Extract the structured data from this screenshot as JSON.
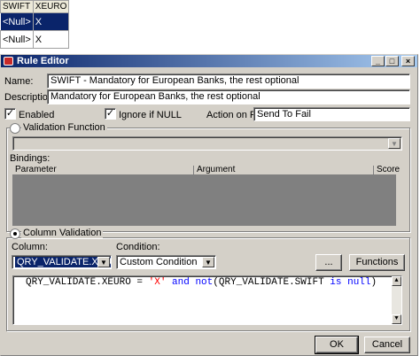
{
  "grid": {
    "columns": [
      "SWIFT",
      "XEURO"
    ],
    "rows": [
      [
        "<Null>",
        "X"
      ],
      [
        "<Null>",
        "X"
      ]
    ]
  },
  "window": {
    "title": "Rule Editor",
    "minimize": "_",
    "maximize": "□",
    "close": "×"
  },
  "form": {
    "name_label": "Name:",
    "name_value": "SWIFT - Mandatory for European Banks, the rest optional",
    "description_label": "Description:",
    "description_value": "Mandatory for European Banks, the rest optional",
    "enabled_label": "Enabled",
    "enabled_checked": "✓",
    "ignore_null_label": "Ignore if NULL",
    "ignore_null_checked": "✓",
    "action_on_fail_label": "Action on Fail:",
    "action_on_fail_value": "Send To Fail"
  },
  "validation_function": {
    "title": "Validation Function",
    "function_value": "",
    "bindings_label": "Bindings:",
    "columns": [
      "Parameter",
      "Argument",
      "Score"
    ]
  },
  "column_validation": {
    "title": "Column Validation",
    "column_label": "Column:",
    "column_value": "QRY_VALIDATE.XEURO",
    "condition_label": "Condition:",
    "condition_value": "Custom Condition",
    "ellipsis_button": "...",
    "functions_button": "Functions",
    "expression": {
      "part1": "QRY_VALIDATE.XEURO = ",
      "string": "'X'",
      "kw_and": " and ",
      "kw_not": "not",
      "part2": "(QRY_VALIDATE.SWIFT ",
      "kw_is": "is",
      "kw_null": " null",
      "part3": ")"
    }
  },
  "buttons": {
    "ok": "OK",
    "cancel": "Cancel"
  },
  "icons": {
    "dropdown": "▼",
    "scroll_up": "▲",
    "scroll_down": "▼"
  },
  "colors": {
    "selection": "#0a246a",
    "dialog_face": "#d4d0c8",
    "keyword": "#0000ff",
    "string_literal": "#ff0000"
  }
}
